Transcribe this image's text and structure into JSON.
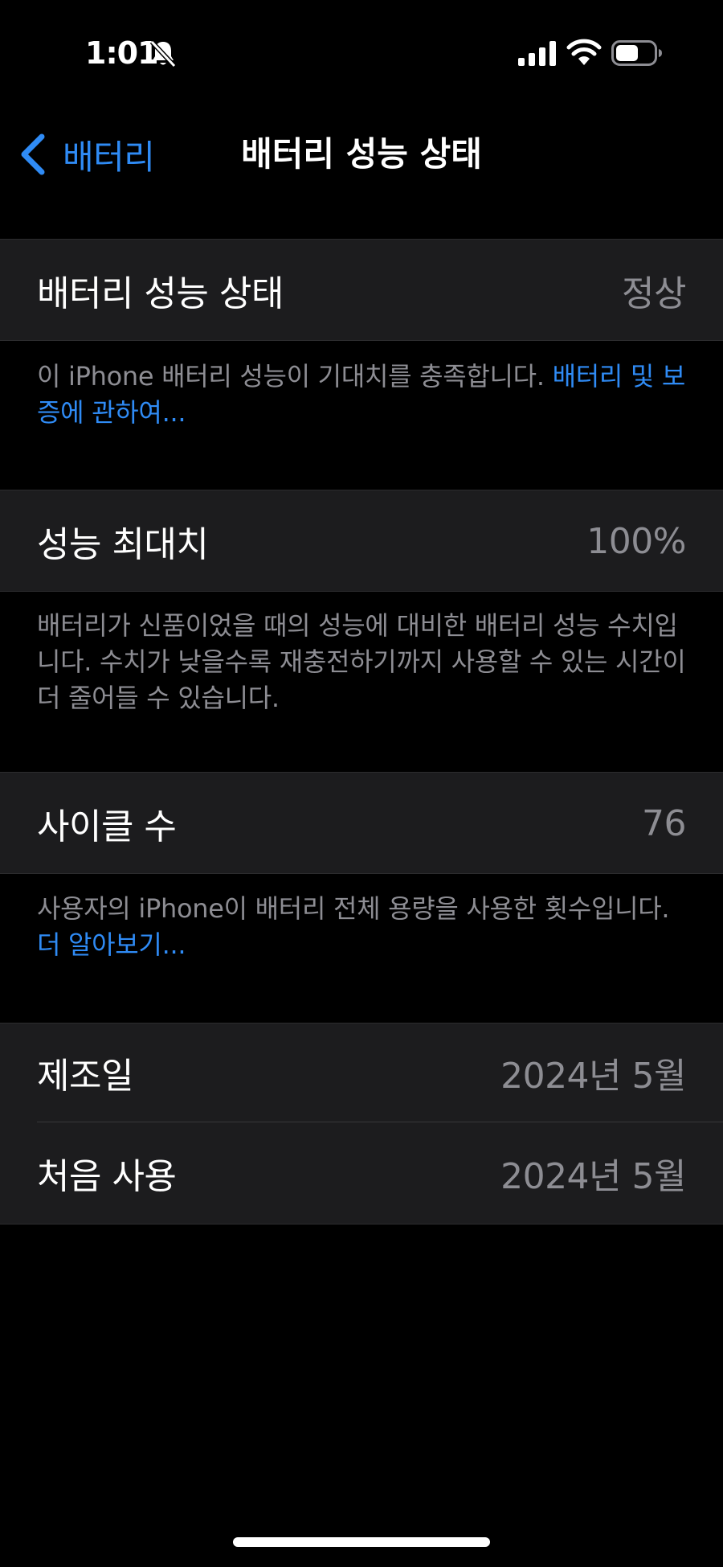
{
  "status_bar": {
    "time": "1:01",
    "icons": [
      "bell-slash-icon",
      "cellular-signal-icon",
      "wifi-icon",
      "battery-icon"
    ],
    "battery_level": 0.6
  },
  "nav": {
    "back_label": "배터리",
    "title": "배터리 성능 상태"
  },
  "sections": {
    "health": {
      "label": "배터리 성능 상태",
      "value": "정상",
      "footer_text": "이 iPhone 배터리 성능이 기대치를 충족합니다. ",
      "footer_link": "배터리 및 보증에 관하여..."
    },
    "max_capacity": {
      "label": "성능 최대치",
      "value": "100%",
      "footer_text": "배터리가 신품이었을 때의 성능에 대비한 배터리 성능 수치입니다. 수치가 낮을수록 재충전하기까지 사용할 수 있는 시간이 더 줄어들 수 있습니다."
    },
    "cycle_count": {
      "label": "사이클 수",
      "value": "76",
      "footer_text": "사용자의 iPhone이 배터리 전체 용량을 사용한 횟수입니다. ",
      "footer_link": "더 알아보기..."
    },
    "dates": {
      "manufacture_label": "제조일",
      "manufacture_value": "2024년 5월",
      "first_use_label": "처음 사용",
      "first_use_value": "2024년 5월"
    }
  },
  "colors": {
    "background": "#000000",
    "group_background": "#1c1c1e",
    "accent": "#2f8bf5",
    "secondary_text": "#8d8d93"
  }
}
